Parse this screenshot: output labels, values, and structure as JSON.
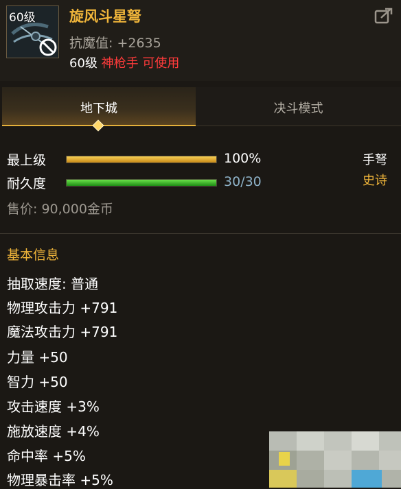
{
  "item": {
    "level_badge": "60级",
    "name": "旋风斗星弩",
    "resist": "抗魔值: +2635",
    "req_level": "60级",
    "req_class": "神枪手 可使用"
  },
  "tabs": [
    {
      "label": "地下城",
      "active": true
    },
    {
      "label": "决斗模式",
      "active": false
    }
  ],
  "bars": {
    "grade": {
      "label": "最上级",
      "value": "100%",
      "fill": 1.0,
      "color": "#e5b030"
    },
    "durability": {
      "label": "耐久度",
      "value": "30/30",
      "fill": 1.0,
      "color": "#36b62a"
    }
  },
  "item_type": "手弩",
  "rarity": "史诗",
  "price": "售价: 90,000金币",
  "section_title": "基本信息",
  "attributes": [
    "抽取速度: 普通",
    "物理攻击力 +791",
    "魔法攻击力 +791",
    "力量 +50",
    "智力 +50",
    "攻击速度 +3%",
    "施放速度 +4%",
    "命中率 +5%",
    "物理暴击率 +5%"
  ],
  "icons": {
    "share": "share-icon",
    "item": "crossbow-icon",
    "locked": "prohibited-icon"
  }
}
